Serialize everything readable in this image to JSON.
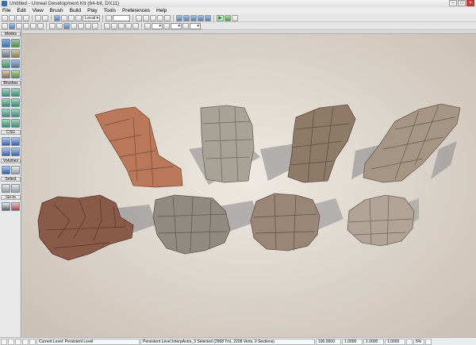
{
  "window": {
    "title": "Untitled - Unreal Development Kit (64-bit, DX11)",
    "controls": [
      "–",
      "□",
      "×"
    ]
  },
  "menu": [
    "File",
    "Edit",
    "View",
    "Brush",
    "Build",
    "Play",
    "Tools",
    "Preferences",
    "Help"
  ],
  "toolbar": {
    "coordinate_space": "Local",
    "play_icon": "play-icon"
  },
  "left_panel": {
    "sections": [
      "Modes",
      "Brushes",
      "CSG",
      "Volumes",
      "Select",
      "Go to"
    ]
  },
  "viewport": {
    "rocks": [
      {
        "name": "rock-tall-orange",
        "color": "#b9785a"
      },
      {
        "name": "rock-tall-gray",
        "color": "#a8a396"
      },
      {
        "name": "rock-tall-brown",
        "color": "#8e7a66"
      },
      {
        "name": "rock-tall-light-brown",
        "color": "#a69485"
      },
      {
        "name": "rock-pile-red",
        "color": "#8a5a48"
      },
      {
        "name": "rock-pile-gray",
        "color": "#8f8b82"
      },
      {
        "name": "rock-pile-brown",
        "color": "#9a8676"
      },
      {
        "name": "rock-pile-light",
        "color": "#b1a396"
      }
    ]
  },
  "statusbar": {
    "current_level": "Current Level:  Persistent Level",
    "selection": "Persistent Level.InterpActor_3 Selected (2968 Tris, 2208 Verts, 0 Sections)",
    "values": [
      "100.0000",
      "1.0000",
      "1.0000",
      "1.0000"
    ],
    "zoom": "5%"
  }
}
